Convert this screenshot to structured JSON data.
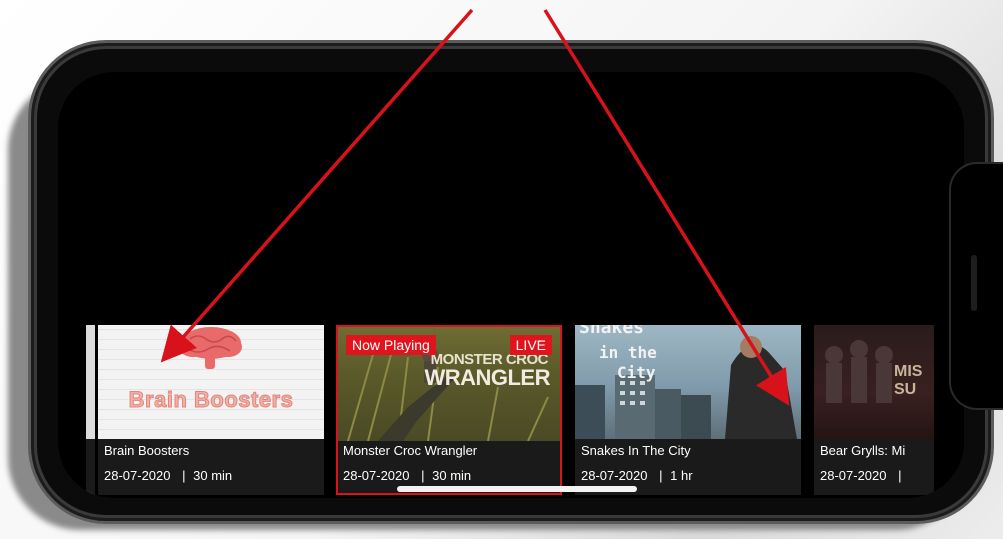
{
  "colors": {
    "accent_red": "#e0141c",
    "arrow_red": "#d8121a",
    "screen_bg": "#000000"
  },
  "cards": [
    {
      "thumb_text": "Brain Boosters",
      "title": "Brain Boosters",
      "date": "28-07-2020",
      "duration": "30 min",
      "active": false
    },
    {
      "thumb_text_top": "MONSTER CROC",
      "thumb_text_bottom": "WRANGLER",
      "title": "Monster Croc Wrangler",
      "date": "28-07-2020",
      "duration": "30 min",
      "active": true,
      "badge_left": "Now Playing",
      "badge_right": "LIVE"
    },
    {
      "thumb_text_1": "Snakes",
      "thumb_text_2": "in the",
      "thumb_text_3": "City",
      "title": "Snakes In The City",
      "date": "28-07-2020",
      "duration": "1 hr",
      "active": false
    },
    {
      "thumb_text": "MIS SU",
      "title": "Bear Grylls: Mi",
      "date": "28-07-2020",
      "duration": "",
      "active": false
    }
  ],
  "separator": "|"
}
